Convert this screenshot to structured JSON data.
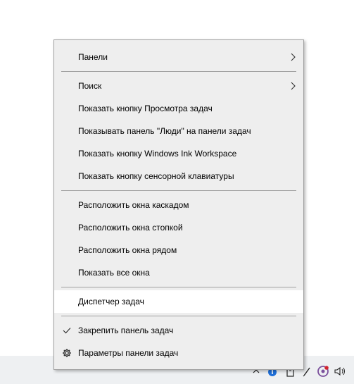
{
  "menu": {
    "items": [
      {
        "label": "Панели",
        "submenu": true
      },
      {
        "label": "Поиск",
        "submenu": true
      },
      {
        "label": "Показать кнопку Просмотра задач"
      },
      {
        "label": "Показывать панель \"Люди\" на панели задач"
      },
      {
        "label": "Показать кнопку Windows Ink Workspace"
      },
      {
        "label": "Показать кнопку сенсорной клавиатуры"
      },
      {
        "label": "Расположить окна каскадом"
      },
      {
        "label": "Расположить окна стопкой"
      },
      {
        "label": "Расположить окна рядом"
      },
      {
        "label": "Показать все окна"
      },
      {
        "label": "Диспетчер задач",
        "highlighted": true
      },
      {
        "label": "Закрепить панель задач",
        "checked": true
      },
      {
        "label": "Параметры панели задач",
        "icon": "gear-icon"
      }
    ]
  },
  "taskbar": {
    "tray_icons": [
      "chevron-up-icon",
      "network-badge-icon",
      "battery-plug-icon",
      "pen-icon",
      "viber-icon",
      "volume-icon"
    ]
  },
  "colors": {
    "menu_background": "#eeeeee",
    "highlight": "#ffffff",
    "separator": "#a0a0a0",
    "taskbar": "#eef0f2"
  }
}
